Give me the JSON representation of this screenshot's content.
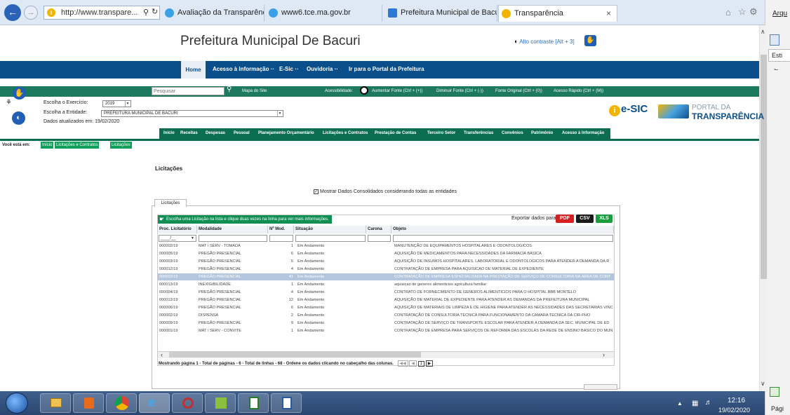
{
  "browser": {
    "address": "http://www.transpare...",
    "tabs": [
      "Avaliação da Transparência do...",
      "www6.tce.ma.gov.br",
      "Prefeitura Municipal de Bacuri",
      "Transparência"
    ],
    "right_panel_items": [
      "Arqu",
      "Esti",
      "Pági"
    ]
  },
  "header": {
    "title": "Prefeitura Municipal De Bacuri",
    "contrast": "Alto contraste [Alt + 3]"
  },
  "topnav": {
    "home": "Home",
    "items": [
      "Acesso à Informação ··",
      "E-Sic ··",
      "Ouvidoria ··",
      "Ir para o Portal da Prefeitura"
    ]
  },
  "sitebar": {
    "search_placeholder": "Pesquisar",
    "map": "Mapa do Site",
    "accessibility": "Acessibilidade:",
    "increase": "Aumentar Fonte (Ctrl + (+))",
    "decrease": "Diminuir Fonte (Ctrl + (-))",
    "original": "Fonte Original (Ctrl + (0))",
    "quick": "Acesso Rápido (Ctrl + (M))"
  },
  "filters": {
    "year_label": "Escolha o Exercício:",
    "year_value": "2019",
    "entity_label": "Escolha a Entidade:",
    "entity_value": "PREFEITURA MUNICIPAL DE BACURI",
    "updated": "Dados atualizados em: 19/02/2020"
  },
  "logos": {
    "esic": "e-SIC",
    "portal_line1": "PORTAL DA",
    "portal_line2": "TRANSPARÊNCIA"
  },
  "greennav": [
    "Início",
    "Receitas",
    "Despesas",
    "Pessoal",
    "Planejamento Orçamentário",
    "Licitações e Contratos",
    "Prestação de Contas",
    "Terceiro Setor",
    "Transferências",
    "Convênios",
    "Patrimônio",
    "Acesso à Informação"
  ],
  "breadcrumb": {
    "label": "Você está em:",
    "items": [
      "Início",
      "Licitações e Contratos",
      "Licitações"
    ]
  },
  "section": {
    "title": "Licitações",
    "consolidated": "Mostrar Dados Consolidados considerando todas as entidades",
    "tab": "Licitações",
    "hint": "Escolha uma Licitação na lista e clique duas vezes na linha para ver mais informações.",
    "export_label": "Exportar dados para:",
    "export": [
      "PDF",
      "CSV",
      "XLS"
    ]
  },
  "table": {
    "columns": [
      "Proc. Licitatório",
      "Modalidade",
      "Nº Mod.",
      "Situação",
      "Carona",
      "Objeto"
    ],
    "filter_proc": "____/__",
    "rows": [
      [
        "000002/19",
        "MAT / SERV - TOMADA",
        "1",
        "Em Andamento",
        "",
        "MANUTENÇÃO DE EQUIPAMENTOS HOSPITALARES E ODONTOLOGICOS"
      ],
      [
        "000005/19",
        "PREGÃO PRESENCIAL",
        "6",
        "Em Andamento",
        "",
        "AQUISIÇÃO DE MEDICAMENTOS PARA NECESSIDADES DA FARMACIA BASICA"
      ],
      [
        "000003/19",
        "PREGÃO PRESENCIAL",
        "5",
        "Em Andamento",
        "",
        "AQUISIÇÃO DE INSUMOS HOSPITALARES, LABORATORIAL E ODONTOLOGICOS PARA ATENDER A DEMANDA DA R"
      ],
      [
        "000012/19",
        "PREGÃO PRESENCIAL",
        "4",
        "Em Andamento",
        "",
        "CONTRATAÇÃO DE EMPRESA PARA AQUISICAO DE MATERIAL DE EXPEDIENTE"
      ],
      [
        "000002/19",
        "PREGÃO PRESENCIAL",
        "41",
        "Em Andamento",
        "",
        "CONTRATAÇÃO DE EMPRESA ESPECIALIZADA NA PRESTAÇÃO DE SERVIÇO DE CONSULTORIA NA ÁREA DE CONT"
      ],
      [
        "000013/19",
        "INEXIGIBILIDADE",
        "1",
        "Em Andamento",
        "",
        "aquisicao de generos alimenticios agricultura familiar"
      ],
      [
        "000004/19",
        "PREGÃO PRESENCIAL",
        "4",
        "Em Andamento",
        "",
        "CONTRATO DE FORNECIMENTO DE GENEROS ALIMENTICIOS PARA O HOSPITAL BBB MONTELO"
      ],
      [
        "000012/19",
        "PREGÃO PRESENCIAL",
        "12",
        "Em Andamento",
        "",
        "AQUISIÇÃO DE MATERIAL DE EXPEDIENTE PARA ATENDER AS DEMANDAS DA PREFEITURA MUNICIPAL"
      ],
      [
        "000006/19",
        "PREGÃO PRESENCIAL",
        "6",
        "Em Andamento",
        "",
        "AQUISIÇÃO DE MATERIAIS DE LIMPEZA E DE HIGIENE PARA ATENDER AS NECESSIDADES DAS SECRETARIAS VINC"
      ],
      [
        "000002/19",
        "DISPENSA",
        "2",
        "Em Andamento",
        "",
        "CONTRATAÇÃO DE CONSULTORIA TECNICA PARA FUNCIONAMENTO DA CAMARA TECNICA DA CIR-PHO"
      ],
      [
        "000009/19",
        "PREGÃO PRESENCIAL",
        "9",
        "Em Andamento",
        "",
        "CONTRATAÇÃO DE SERVIÇO DE TRANSPORTE ESCOLAR PARA ATENDER A DEMANDA DA SEC. MUNICIPAL DE ED"
      ],
      [
        "000001/19",
        "MAT / SERV - CONVITE",
        "1",
        "Em Andamento",
        "",
        "CONTRATAÇÃO DE EMPRESA PARA SERVIÇOS DE REFORMA DAS ESCOLAS DA REDE DE ENSINO BASICO DO MUN"
      ]
    ],
    "selected_row": 4,
    "pager": "Mostrando página 1 - Total de páginas - 6 - Total de linhas - 68 - Ordene os dados clicando no cabeçalho das colunas.",
    "pager_page": "1"
  },
  "taskbar": {
    "time": "12:16",
    "date": "19/02/2020"
  }
}
